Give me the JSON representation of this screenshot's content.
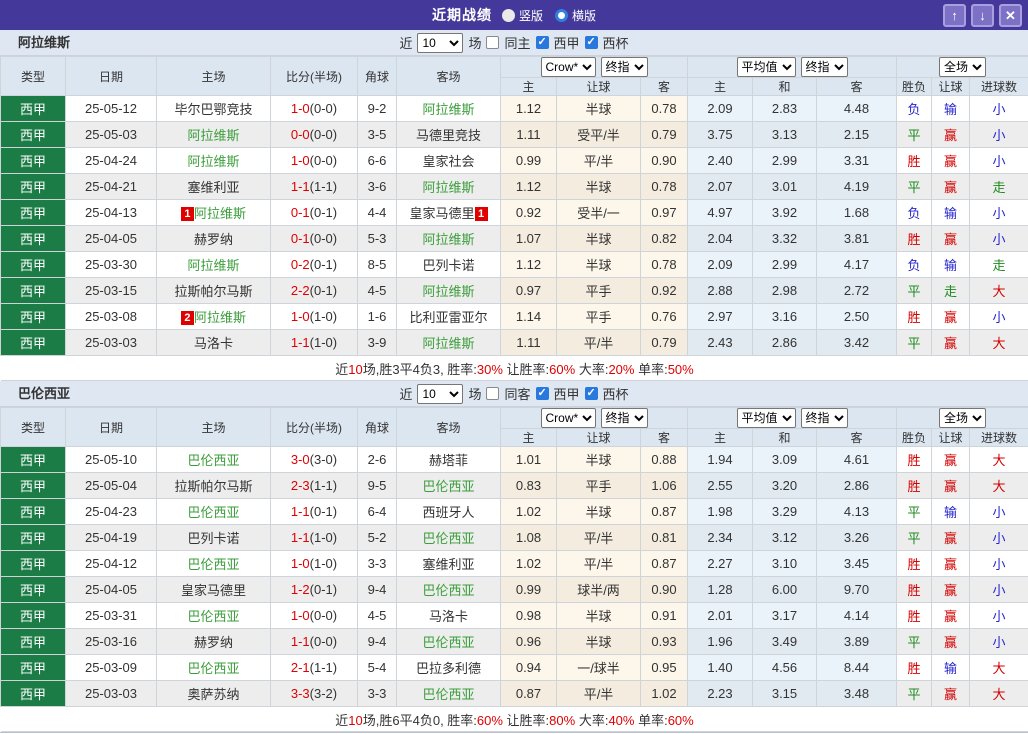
{
  "titlebar": {
    "title": "近期战绩",
    "radio_vertical": "竖版",
    "radio_horizontal": "横版",
    "up_button": "↑",
    "down_button": "↓",
    "close_button": "✕"
  },
  "labels": {
    "col_type": "类型",
    "col_date": "日期",
    "col_home": "主场",
    "col_score": "比分(半场)",
    "col_corner": "角球",
    "col_away": "客场",
    "col_ah_home": "主",
    "col_ah_line": "让球",
    "col_ah_away": "客",
    "col_eu_home": "主",
    "col_eu_draw": "和",
    "col_eu_away": "客",
    "col_result": "胜负",
    "col_cover": "让球",
    "col_goals": "进球数"
  },
  "colors": {
    "titlebar_bg": "#44399a",
    "section_bar_bg": "#dee7f2",
    "header_bg": "#dce6f1",
    "league_cell_bg": "#1b7c46",
    "subject_team": "#3b9e3b",
    "win_red": "#d30000",
    "draw_green": "#1e8a1e",
    "lose_blue": "#2525cd",
    "score_red": "#e00000"
  },
  "sections": [
    {
      "team": "阿拉维斯",
      "filters": {
        "near": "近",
        "count": "10",
        "matches": "场",
        "same": "同主",
        "same_checked": false,
        "league": "西甲",
        "league_checked": true,
        "cup": "西杯",
        "cup_checked": true
      },
      "dropdowns": {
        "ah_source": "Crow*",
        "ah_time": "终指",
        "eu_source": "平均值",
        "eu_time": "终指",
        "scope": "全场"
      },
      "rows": [
        {
          "type": "西甲",
          "date": "25-05-12",
          "home": "毕尔巴鄂竞技",
          "home_subject": false,
          "home_badge": "",
          "score": "1-0",
          "half": "(0-0)",
          "corner": "9-2",
          "away": "阿拉维斯",
          "away_subject": true,
          "away_badge": "",
          "ah_home": "1.12",
          "ah_line": "半球",
          "ah_away": "0.78",
          "eu_home": "2.09",
          "eu_draw": "2.83",
          "eu_away": "4.48",
          "result": "负",
          "result_color": "blue",
          "cover": "输",
          "cover_color": "blue",
          "goals": "小",
          "goals_color": "blue"
        },
        {
          "type": "西甲",
          "date": "25-05-03",
          "home": "阿拉维斯",
          "home_subject": true,
          "home_badge": "",
          "score": "0-0",
          "half": "(0-0)",
          "corner": "3-5",
          "away": "马德里竞技",
          "away_subject": false,
          "away_badge": "",
          "ah_home": "1.11",
          "ah_line": "受平/半",
          "ah_away": "0.79",
          "eu_home": "3.75",
          "eu_draw": "3.13",
          "eu_away": "2.15",
          "result": "平",
          "result_color": "green",
          "cover": "赢",
          "cover_color": "red",
          "goals": "小",
          "goals_color": "blue"
        },
        {
          "type": "西甲",
          "date": "25-04-24",
          "home": "阿拉维斯",
          "home_subject": true,
          "home_badge": "",
          "score": "1-0",
          "half": "(0-0)",
          "corner": "6-6",
          "away": "皇家社会",
          "away_subject": false,
          "away_badge": "",
          "ah_home": "0.99",
          "ah_line": "平/半",
          "ah_away": "0.90",
          "eu_home": "2.40",
          "eu_draw": "2.99",
          "eu_away": "3.31",
          "result": "胜",
          "result_color": "red",
          "cover": "赢",
          "cover_color": "red",
          "goals": "小",
          "goals_color": "blue"
        },
        {
          "type": "西甲",
          "date": "25-04-21",
          "home": "塞维利亚",
          "home_subject": false,
          "home_badge": "",
          "score": "1-1",
          "half": "(1-1)",
          "corner": "3-6",
          "away": "阿拉维斯",
          "away_subject": true,
          "away_badge": "",
          "ah_home": "1.12",
          "ah_line": "半球",
          "ah_away": "0.78",
          "eu_home": "2.07",
          "eu_draw": "3.01",
          "eu_away": "4.19",
          "result": "平",
          "result_color": "green",
          "cover": "赢",
          "cover_color": "red",
          "goals": "走",
          "goals_color": "green"
        },
        {
          "type": "西甲",
          "date": "25-04-13",
          "home": "阿拉维斯",
          "home_subject": true,
          "home_badge": "1",
          "score": "0-1",
          "half": "(0-1)",
          "corner": "4-4",
          "away": "皇家马德里",
          "away_subject": false,
          "away_badge": "1",
          "ah_home": "0.92",
          "ah_line": "受半/一",
          "ah_away": "0.97",
          "eu_home": "4.97",
          "eu_draw": "3.92",
          "eu_away": "1.68",
          "result": "负",
          "result_color": "blue",
          "cover": "输",
          "cover_color": "blue",
          "goals": "小",
          "goals_color": "blue"
        },
        {
          "type": "西甲",
          "date": "25-04-05",
          "home": "赫罗纳",
          "home_subject": false,
          "home_badge": "",
          "score": "0-1",
          "half": "(0-0)",
          "corner": "5-3",
          "away": "阿拉维斯",
          "away_subject": true,
          "away_badge": "",
          "ah_home": "1.07",
          "ah_line": "半球",
          "ah_away": "0.82",
          "eu_home": "2.04",
          "eu_draw": "3.32",
          "eu_away": "3.81",
          "result": "胜",
          "result_color": "red",
          "cover": "赢",
          "cover_color": "red",
          "goals": "小",
          "goals_color": "blue"
        },
        {
          "type": "西甲",
          "date": "25-03-30",
          "home": "阿拉维斯",
          "home_subject": true,
          "home_badge": "",
          "score": "0-2",
          "half": "(0-1)",
          "corner": "8-5",
          "away": "巴列卡诺",
          "away_subject": false,
          "away_badge": "",
          "ah_home": "1.12",
          "ah_line": "半球",
          "ah_away": "0.78",
          "eu_home": "2.09",
          "eu_draw": "2.99",
          "eu_away": "4.17",
          "result": "负",
          "result_color": "blue",
          "cover": "输",
          "cover_color": "blue",
          "goals": "走",
          "goals_color": "green"
        },
        {
          "type": "西甲",
          "date": "25-03-15",
          "home": "拉斯帕尔马斯",
          "home_subject": false,
          "home_badge": "",
          "score": "2-2",
          "half": "(0-1)",
          "corner": "4-5",
          "away": "阿拉维斯",
          "away_subject": true,
          "away_badge": "",
          "ah_home": "0.97",
          "ah_line": "平手",
          "ah_away": "0.92",
          "eu_home": "2.88",
          "eu_draw": "2.98",
          "eu_away": "2.72",
          "result": "平",
          "result_color": "green",
          "cover": "走",
          "cover_color": "green",
          "goals": "大",
          "goals_color": "red"
        },
        {
          "type": "西甲",
          "date": "25-03-08",
          "home": "阿拉维斯",
          "home_subject": true,
          "home_badge": "2",
          "score": "1-0",
          "half": "(1-0)",
          "corner": "1-6",
          "away": "比利亚雷亚尔",
          "away_subject": false,
          "away_badge": "",
          "ah_home": "1.14",
          "ah_line": "平手",
          "ah_away": "0.76",
          "eu_home": "2.97",
          "eu_draw": "3.16",
          "eu_away": "2.50",
          "result": "胜",
          "result_color": "red",
          "cover": "赢",
          "cover_color": "red",
          "goals": "小",
          "goals_color": "blue"
        },
        {
          "type": "西甲",
          "date": "25-03-03",
          "home": "马洛卡",
          "home_subject": false,
          "home_badge": "",
          "score": "1-1",
          "half": "(1-0)",
          "corner": "3-9",
          "away": "阿拉维斯",
          "away_subject": true,
          "away_badge": "",
          "ah_home": "1.11",
          "ah_line": "平/半",
          "ah_away": "0.79",
          "eu_home": "2.43",
          "eu_draw": "2.86",
          "eu_away": "3.42",
          "result": "平",
          "result_color": "green",
          "cover": "赢",
          "cover_color": "red",
          "goals": "大",
          "goals_color": "red"
        }
      ],
      "summary": [
        {
          "text": "近"
        },
        {
          "text": "10",
          "red": true
        },
        {
          "text": "场,胜3平4负3, 胜率:"
        },
        {
          "text": "30%",
          "red": true
        },
        {
          "text": " 让胜率:"
        },
        {
          "text": "60%",
          "red": true
        },
        {
          "text": " 大率:"
        },
        {
          "text": "20%",
          "red": true
        },
        {
          "text": " 单率:"
        },
        {
          "text": "50%",
          "red": true
        }
      ]
    },
    {
      "team": "巴伦西亚",
      "filters": {
        "near": "近",
        "count": "10",
        "matches": "场",
        "same": "同客",
        "same_checked": false,
        "league": "西甲",
        "league_checked": true,
        "cup": "西杯",
        "cup_checked": true
      },
      "dropdowns": {
        "ah_source": "Crow*",
        "ah_time": "终指",
        "eu_source": "平均值",
        "eu_time": "终指",
        "scope": "全场"
      },
      "rows": [
        {
          "type": "西甲",
          "date": "25-05-10",
          "home": "巴伦西亚",
          "home_subject": true,
          "home_badge": "",
          "score": "3-0",
          "half": "(3-0)",
          "corner": "2-6",
          "away": "赫塔菲",
          "away_subject": false,
          "away_badge": "",
          "ah_home": "1.01",
          "ah_line": "半球",
          "ah_away": "0.88",
          "eu_home": "1.94",
          "eu_draw": "3.09",
          "eu_away": "4.61",
          "result": "胜",
          "result_color": "red",
          "cover": "赢",
          "cover_color": "red",
          "goals": "大",
          "goals_color": "red"
        },
        {
          "type": "西甲",
          "date": "25-05-04",
          "home": "拉斯帕尔马斯",
          "home_subject": false,
          "home_badge": "",
          "score": "2-3",
          "half": "(1-1)",
          "corner": "9-5",
          "away": "巴伦西亚",
          "away_subject": true,
          "away_badge": "",
          "ah_home": "0.83",
          "ah_line": "平手",
          "ah_away": "1.06",
          "eu_home": "2.55",
          "eu_draw": "3.20",
          "eu_away": "2.86",
          "result": "胜",
          "result_color": "red",
          "cover": "赢",
          "cover_color": "red",
          "goals": "大",
          "goals_color": "red"
        },
        {
          "type": "西甲",
          "date": "25-04-23",
          "home": "巴伦西亚",
          "home_subject": true,
          "home_badge": "",
          "score": "1-1",
          "half": "(0-1)",
          "corner": "6-4",
          "away": "西班牙人",
          "away_subject": false,
          "away_badge": "",
          "ah_home": "1.02",
          "ah_line": "半球",
          "ah_away": "0.87",
          "eu_home": "1.98",
          "eu_draw": "3.29",
          "eu_away": "4.13",
          "result": "平",
          "result_color": "green",
          "cover": "输",
          "cover_color": "blue",
          "goals": "小",
          "goals_color": "blue"
        },
        {
          "type": "西甲",
          "date": "25-04-19",
          "home": "巴列卡诺",
          "home_subject": false,
          "home_badge": "",
          "score": "1-1",
          "half": "(1-0)",
          "corner": "5-2",
          "away": "巴伦西亚",
          "away_subject": true,
          "away_badge": "",
          "ah_home": "1.08",
          "ah_line": "平/半",
          "ah_away": "0.81",
          "eu_home": "2.34",
          "eu_draw": "3.12",
          "eu_away": "3.26",
          "result": "平",
          "result_color": "green",
          "cover": "赢",
          "cover_color": "red",
          "goals": "小",
          "goals_color": "blue"
        },
        {
          "type": "西甲",
          "date": "25-04-12",
          "home": "巴伦西亚",
          "home_subject": true,
          "home_badge": "",
          "score": "1-0",
          "half": "(1-0)",
          "corner": "3-3",
          "away": "塞维利亚",
          "away_subject": false,
          "away_badge": "",
          "ah_home": "1.02",
          "ah_line": "平/半",
          "ah_away": "0.87",
          "eu_home": "2.27",
          "eu_draw": "3.10",
          "eu_away": "3.45",
          "result": "胜",
          "result_color": "red",
          "cover": "赢",
          "cover_color": "red",
          "goals": "小",
          "goals_color": "blue"
        },
        {
          "type": "西甲",
          "date": "25-04-05",
          "home": "皇家马德里",
          "home_subject": false,
          "home_badge": "",
          "score": "1-2",
          "half": "(0-1)",
          "corner": "9-4",
          "away": "巴伦西亚",
          "away_subject": true,
          "away_badge": "",
          "ah_home": "0.99",
          "ah_line": "球半/两",
          "ah_away": "0.90",
          "eu_home": "1.28",
          "eu_draw": "6.00",
          "eu_away": "9.70",
          "result": "胜",
          "result_color": "red",
          "cover": "赢",
          "cover_color": "red",
          "goals": "小",
          "goals_color": "blue"
        },
        {
          "type": "西甲",
          "date": "25-03-31",
          "home": "巴伦西亚",
          "home_subject": true,
          "home_badge": "",
          "score": "1-0",
          "half": "(0-0)",
          "corner": "4-5",
          "away": "马洛卡",
          "away_subject": false,
          "away_badge": "",
          "ah_home": "0.98",
          "ah_line": "半球",
          "ah_away": "0.91",
          "eu_home": "2.01",
          "eu_draw": "3.17",
          "eu_away": "4.14",
          "result": "胜",
          "result_color": "red",
          "cover": "赢",
          "cover_color": "red",
          "goals": "小",
          "goals_color": "blue"
        },
        {
          "type": "西甲",
          "date": "25-03-16",
          "home": "赫罗纳",
          "home_subject": false,
          "home_badge": "",
          "score": "1-1",
          "half": "(0-0)",
          "corner": "9-4",
          "away": "巴伦西亚",
          "away_subject": true,
          "away_badge": "",
          "ah_home": "0.96",
          "ah_line": "半球",
          "ah_away": "0.93",
          "eu_home": "1.96",
          "eu_draw": "3.49",
          "eu_away": "3.89",
          "result": "平",
          "result_color": "green",
          "cover": "赢",
          "cover_color": "red",
          "goals": "小",
          "goals_color": "blue"
        },
        {
          "type": "西甲",
          "date": "25-03-09",
          "home": "巴伦西亚",
          "home_subject": true,
          "home_badge": "",
          "score": "2-1",
          "half": "(1-1)",
          "corner": "5-4",
          "away": "巴拉多利德",
          "away_subject": false,
          "away_badge": "",
          "ah_home": "0.94",
          "ah_line": "一/球半",
          "ah_away": "0.95",
          "eu_home": "1.40",
          "eu_draw": "4.56",
          "eu_away": "8.44",
          "result": "胜",
          "result_color": "red",
          "cover": "输",
          "cover_color": "blue",
          "goals": "大",
          "goals_color": "red"
        },
        {
          "type": "西甲",
          "date": "25-03-03",
          "home": "奥萨苏纳",
          "home_subject": false,
          "home_badge": "",
          "score": "3-3",
          "half": "(3-2)",
          "corner": "3-3",
          "away": "巴伦西亚",
          "away_subject": true,
          "away_badge": "",
          "ah_home": "0.87",
          "ah_line": "平/半",
          "ah_away": "1.02",
          "eu_home": "2.23",
          "eu_draw": "3.15",
          "eu_away": "3.48",
          "result": "平",
          "result_color": "green",
          "cover": "赢",
          "cover_color": "red",
          "goals": "大",
          "goals_color": "red"
        }
      ],
      "summary": [
        {
          "text": "近"
        },
        {
          "text": "10",
          "red": true
        },
        {
          "text": "场,胜6平4负0, 胜率:"
        },
        {
          "text": "60%",
          "red": true
        },
        {
          "text": " 让胜率:"
        },
        {
          "text": "80%",
          "red": true
        },
        {
          "text": " 大率:"
        },
        {
          "text": "40%",
          "red": true
        },
        {
          "text": " 单率:"
        },
        {
          "text": "60%",
          "red": true
        }
      ]
    }
  ]
}
